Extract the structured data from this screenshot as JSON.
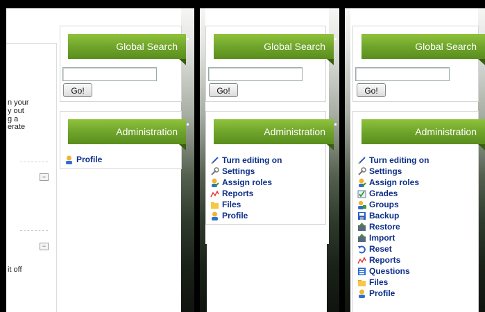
{
  "panels": [
    {
      "global_search": {
        "title": "Global Search",
        "input_value": "",
        "go_label": "Go!"
      },
      "administration": {
        "title": "Administration",
        "items": [
          {
            "label": "Profile",
            "icon": "profile-icon"
          }
        ]
      },
      "content_fragments": [
        "n your",
        "y out",
        "g a",
        "erate",
        "it off"
      ],
      "collapse_label": "−"
    },
    {
      "global_search": {
        "title": "Global Search",
        "input_value": "",
        "go_label": "Go!"
      },
      "administration": {
        "title": "Administration",
        "items": [
          {
            "label": "Turn editing on",
            "icon": "pencil-icon"
          },
          {
            "label": "Settings",
            "icon": "wrench-icon"
          },
          {
            "label": "Assign roles",
            "icon": "roles-icon"
          },
          {
            "label": "Reports",
            "icon": "reports-icon"
          },
          {
            "label": "Files",
            "icon": "folder-icon"
          },
          {
            "label": "Profile",
            "icon": "profile-icon"
          }
        ]
      }
    },
    {
      "global_search": {
        "title": "Global Search",
        "input_value": "",
        "go_label": "Go!"
      },
      "administration": {
        "title": "Administration",
        "items": [
          {
            "label": "Turn editing on",
            "icon": "pencil-icon"
          },
          {
            "label": "Settings",
            "icon": "wrench-icon"
          },
          {
            "label": "Assign roles",
            "icon": "roles-icon"
          },
          {
            "label": "Grades",
            "icon": "grades-icon"
          },
          {
            "label": "Groups",
            "icon": "groups-icon"
          },
          {
            "label": "Backup",
            "icon": "backup-icon"
          },
          {
            "label": "Restore",
            "icon": "restore-icon"
          },
          {
            "label": "Import",
            "icon": "import-icon"
          },
          {
            "label": "Reset",
            "icon": "reset-icon"
          },
          {
            "label": "Reports",
            "icon": "reports-icon"
          },
          {
            "label": "Questions",
            "icon": "questions-icon"
          },
          {
            "label": "Files",
            "icon": "folder-icon"
          },
          {
            "label": "Profile",
            "icon": "profile-icon"
          }
        ]
      }
    }
  ],
  "colors": {
    "banner_green": "#6da22a",
    "link_blue": "#0c2e88"
  }
}
